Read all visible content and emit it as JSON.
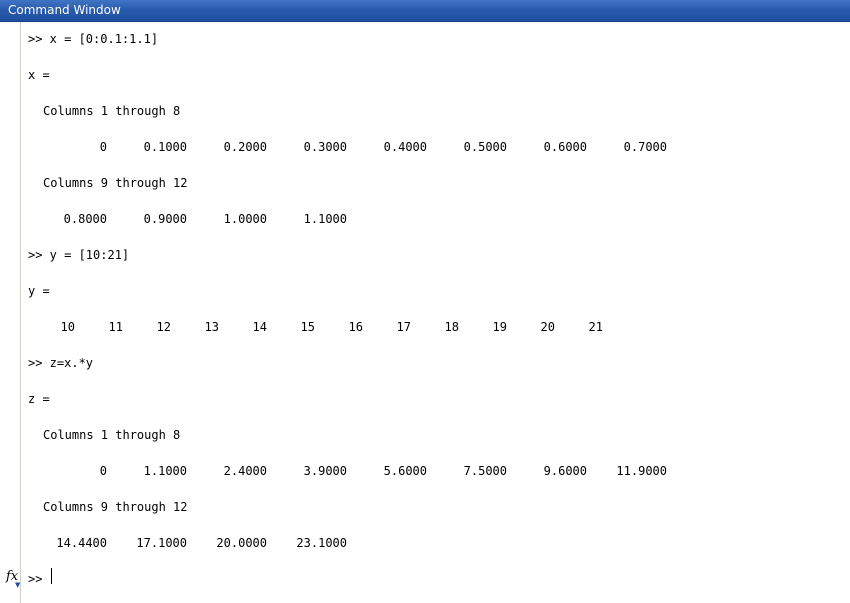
{
  "window": {
    "title": "Command Window"
  },
  "commands": {
    "cmd_x": ">> x = [0:0.1:1.1]",
    "cmd_y": ">> y = [10:21]",
    "cmd_z": ">> z=x.*y"
  },
  "outputs": {
    "x_label": "x =",
    "x_cols_1": "Columns 1 through 8",
    "x_values_1": [
      "0",
      "0.1000",
      "0.2000",
      "0.3000",
      "0.4000",
      "0.5000",
      "0.6000",
      "0.7000"
    ],
    "x_cols_2": "Columns 9 through 12",
    "x_values_2": [
      "0.8000",
      "0.9000",
      "1.0000",
      "1.1000"
    ],
    "y_label": "y =",
    "y_values": [
      "10",
      "11",
      "12",
      "13",
      "14",
      "15",
      "16",
      "17",
      "18",
      "19",
      "20",
      "21"
    ],
    "z_label": "z =",
    "z_cols_1": "Columns 1 through 8",
    "z_values_1": [
      "0",
      "1.1000",
      "2.4000",
      "3.9000",
      "5.6000",
      "7.5000",
      "9.6000",
      "11.9000"
    ],
    "z_cols_2": "Columns 9 through 12",
    "z_values_2": [
      "14.4400",
      "17.1000",
      "20.0000",
      "23.1000"
    ]
  },
  "prompt": {
    "symbol": ">>",
    "fx_label": "fx",
    "current_input": ""
  },
  "icons": {
    "function_browser": "fx-icon"
  },
  "colors": {
    "titlebar": "#2a5cad",
    "title_text": "#ffffff",
    "background": "#ffffff",
    "text": "#000000"
  }
}
